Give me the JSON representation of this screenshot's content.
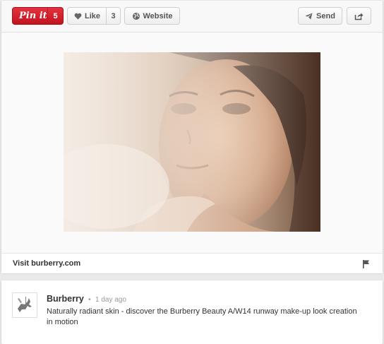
{
  "toolbar": {
    "pin_label": "Pin it",
    "pin_count": "5",
    "like_label": "Like",
    "like_count": "3",
    "website_label": "Website",
    "send_label": "Send"
  },
  "icons": {
    "like": "heart-icon",
    "website": "globe-icon",
    "send": "paper-plane-icon",
    "share": "share-arrow-icon",
    "flag": "flag-icon"
  },
  "colors": {
    "pin_button": "#cb1f27",
    "background": "#e9e9e9"
  },
  "visit": {
    "label": "Visit burberry.com"
  },
  "pinner": {
    "name": "Burberry",
    "separator": "•",
    "time": "1 day ago",
    "description": "Naturally radiant skin - discover the Burberry Beauty A/W14 runway make-up look creation in motion"
  }
}
